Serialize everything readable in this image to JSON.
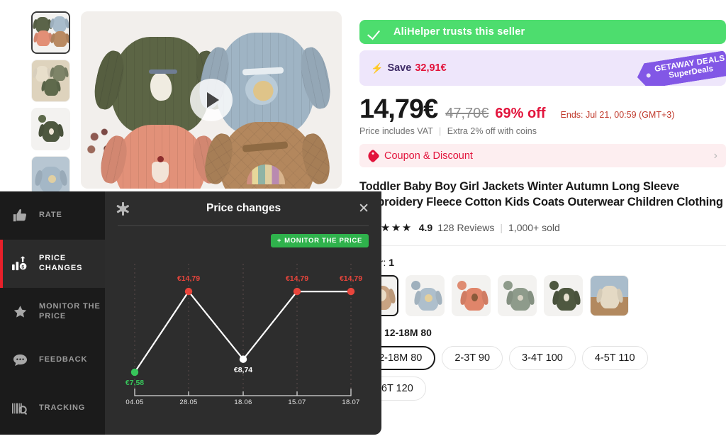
{
  "trust": {
    "text": "AliHelper trusts this seller",
    "icon": "check-icon",
    "color": "#4ddd6e"
  },
  "save_banner": {
    "label": "Save",
    "amount": "32,91€",
    "bolt_icon": "lightning-bolt-icon",
    "deal_tag_line1": "GETAWAY DEALS",
    "deal_tag_line2": "SuperDeals",
    "tag_color": "#8257e6"
  },
  "price": {
    "current": "14,79€",
    "original": "47,70€",
    "discount": "69% off",
    "ends": "Ends: Jul 21, 00:59 (GMT+3)",
    "vat_note": "Price includes VAT",
    "coins_note": "Extra 2% off with coins"
  },
  "coupon": {
    "label": "Coupon & Discount",
    "icon": "price-tag-icon",
    "chevron": "›"
  },
  "product": {
    "title": "Toddler Baby Boy Girl Jackets Winter Autumn Long Sleeve Embroidery Fleece Cotton Kids Coats Outerwear Children Clothing",
    "stars": "★★★★★",
    "rating": "4.9",
    "reviews": "128 Reviews",
    "separator": "|",
    "sold": "1,000+ sold"
  },
  "options": {
    "color_label": "Color:",
    "color_value": "1",
    "size_label": "Size:",
    "size_value": "12-18M 80",
    "colors": [
      {
        "name": "tan-bunny",
        "selected": true,
        "body": "#c8a382",
        "emb": "#e9dcc6"
      },
      {
        "name": "blue",
        "selected": false,
        "body": "#aebfcc",
        "emb": "#e4cf9b"
      },
      {
        "name": "pink",
        "selected": false,
        "body": "#e0856a",
        "emb": "#8a5a3a"
      },
      {
        "name": "sage",
        "selected": false,
        "body": "#8e9b8b",
        "emb": "#d8d3c4"
      },
      {
        "name": "olive",
        "selected": false,
        "body": "#4e5840",
        "emb": "#e6e0cf"
      },
      {
        "name": "cream-set",
        "selected": false,
        "body": "#e4d9c4",
        "emb": "#cbb79a"
      }
    ],
    "sizes": [
      {
        "label": "12-18M 80",
        "selected": true
      },
      {
        "label": "2-3T 90",
        "selected": false
      },
      {
        "label": "3-4T 100",
        "selected": false
      },
      {
        "label": "4-5T 110",
        "selected": false
      },
      {
        "label": "5-6T 120",
        "selected": false
      }
    ]
  },
  "gallery": {
    "thumbs": [
      {
        "name": "thumb-group-jackets",
        "selected": true
      },
      {
        "name": "thumb-flatlay",
        "selected": false
      },
      {
        "name": "thumb-olive-jacket",
        "selected": false
      },
      {
        "name": "thumb-blue-jacket",
        "selected": false
      }
    ],
    "play_icon": "play-button-icon"
  },
  "extension": {
    "sidebar": [
      {
        "label": "RATE",
        "icon": "thumbs-up-icon",
        "active": false
      },
      {
        "label": "PRICE CHANGES",
        "icon": "bar-chart-icon",
        "active": true
      },
      {
        "label": "MONITOR THE PRICE",
        "icon": "star-icon",
        "active": false
      },
      {
        "label": "FEEDBACK",
        "icon": "chat-bubble-icon",
        "active": false
      },
      {
        "label": "TRACKING",
        "icon": "barcode-scan-icon",
        "active": false
      }
    ],
    "panel": {
      "title": "Price changes",
      "settings_icon": "gear-icon",
      "close_icon": "close-icon",
      "monitor_button": "MONITOR THE PRICE",
      "monitor_plus": "+",
      "accent_green": "#2fb24c",
      "accent_red": "#e8453c"
    }
  },
  "chart_data": {
    "type": "line",
    "title": "Price changes",
    "xlabel": "",
    "ylabel": "",
    "x": [
      "04.05",
      "28.05",
      "18.06",
      "15.07",
      "18.07"
    ],
    "categories": [
      "04.05",
      "28.05",
      "18.06",
      "15.07",
      "18.07"
    ],
    "values": [
      7.58,
      14.79,
      8.74,
      14.79,
      14.79
    ],
    "point_labels": [
      "€7,58",
      "€14,79",
      "€8,74",
      "€14,79",
      "€14,79"
    ],
    "point_colors": [
      "#37c45a",
      "#e8453c",
      "#ffffff",
      "#e8453c",
      "#e8453c"
    ],
    "label_colors": [
      "#37c45a",
      "#e8453c",
      "#ffffff",
      "#e8453c",
      "#e8453c"
    ],
    "line_color": "#ffffff",
    "currency": "€",
    "ylim": [
      6.5,
      16.0
    ],
    "grid": true,
    "legend": false
  }
}
